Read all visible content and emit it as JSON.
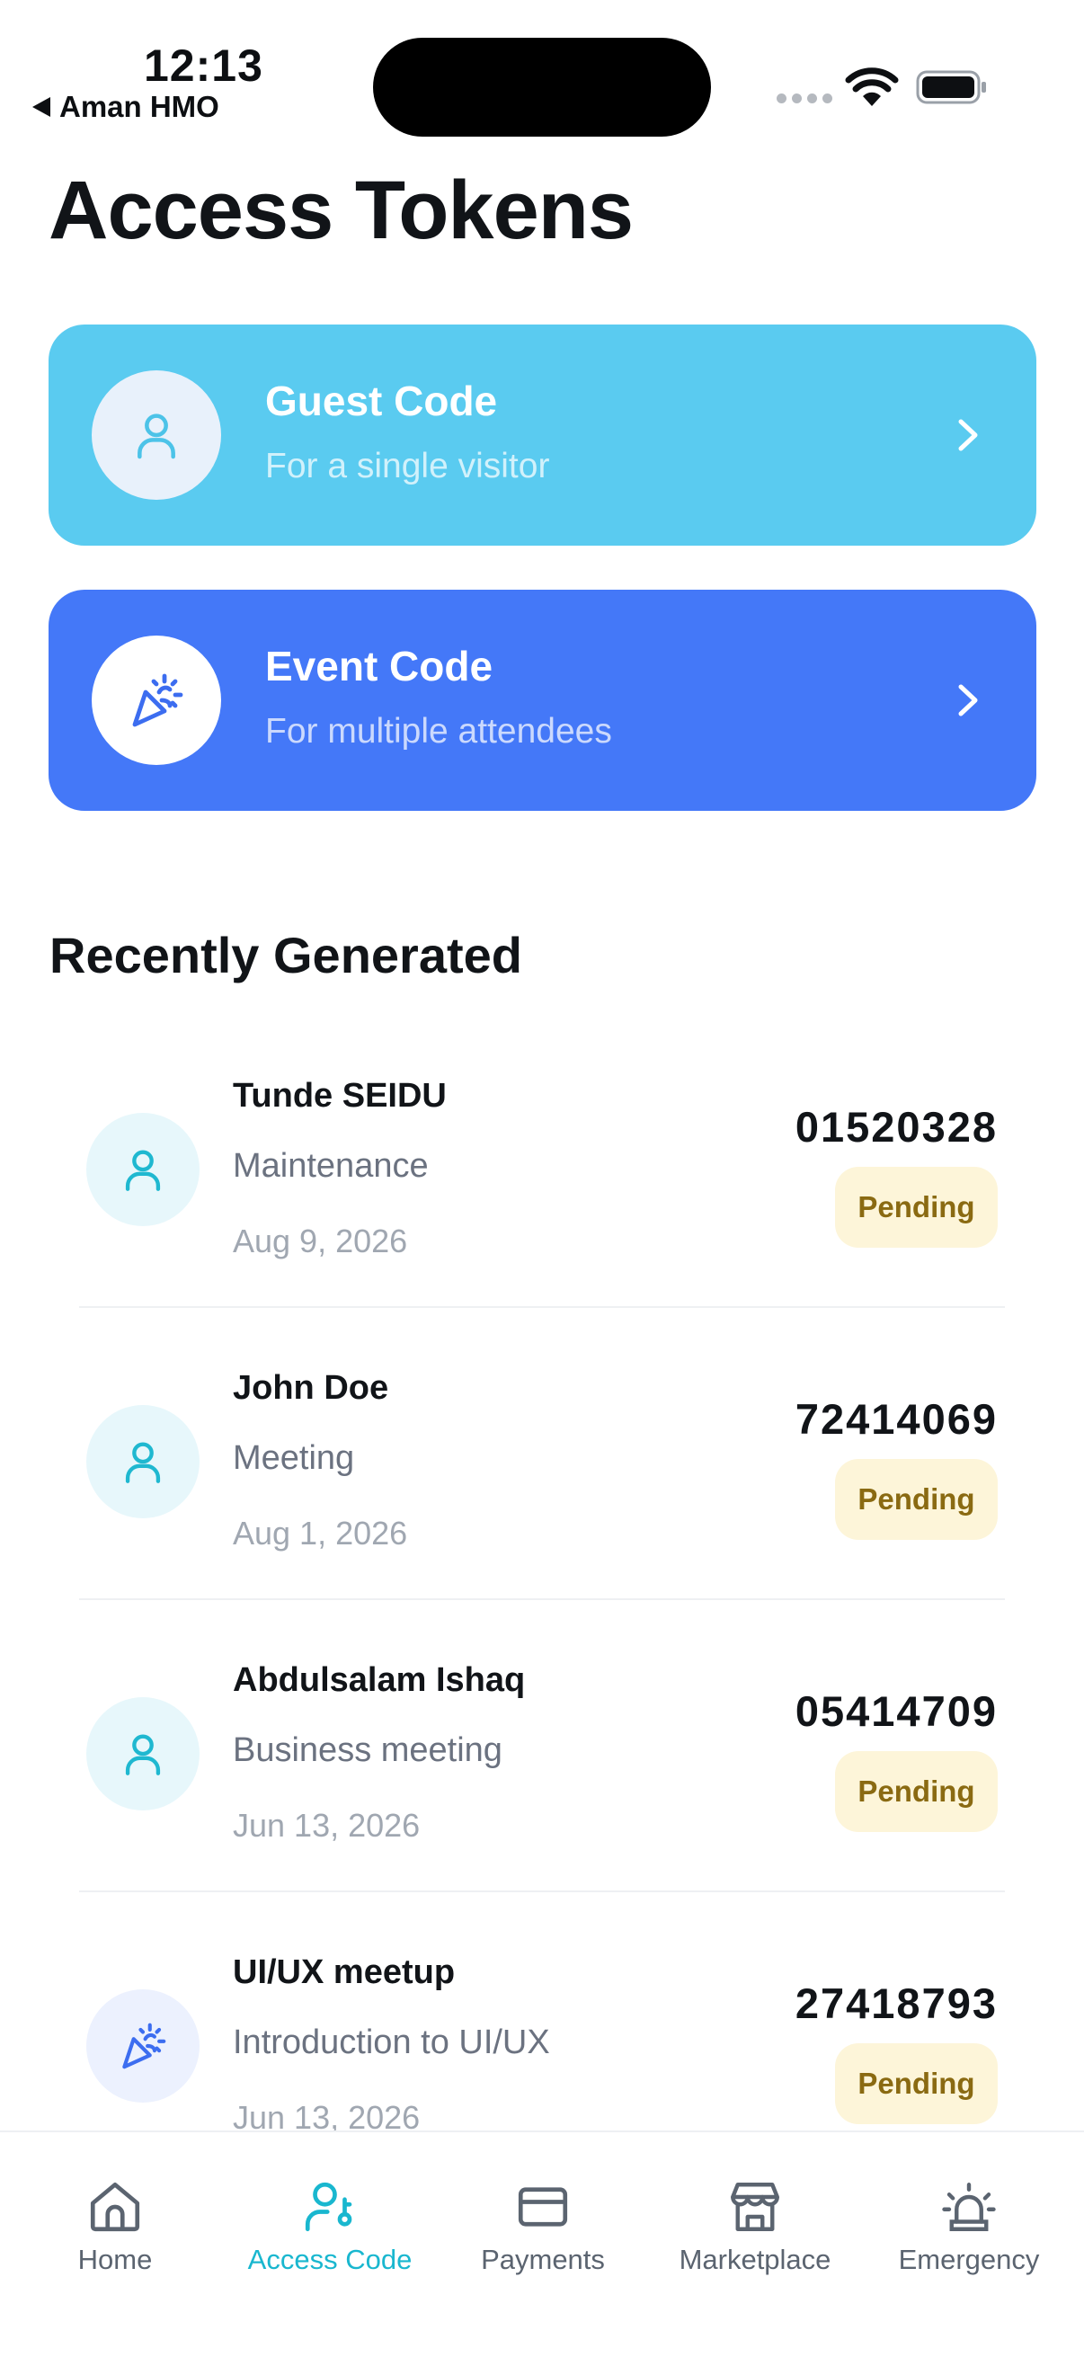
{
  "status_bar": {
    "time": "12:13",
    "back_app": "Aman HMO"
  },
  "page": {
    "title": "Access Tokens"
  },
  "cards": [
    {
      "title": "Guest Code",
      "subtitle": "For a single visitor",
      "icon": "user-icon",
      "color": "#5acbf0"
    },
    {
      "title": "Event Code",
      "subtitle": "For multiple attendees",
      "icon": "party-popper-icon",
      "color": "#4478f8"
    }
  ],
  "recent": {
    "title": "Recently Generated",
    "items": [
      {
        "name": "Tunde SEIDU",
        "purpose": "Maintenance",
        "date": "Aug 9, 2026",
        "code": "01520328",
        "status": "Pending",
        "icon": "user-icon"
      },
      {
        "name": "John Doe",
        "purpose": "Meeting",
        "date": "Aug 1, 2026",
        "code": "72414069",
        "status": "Pending",
        "icon": "user-icon"
      },
      {
        "name": "Abdulsalam Ishaq",
        "purpose": "Business meeting",
        "date": "Jun 13, 2026",
        "code": "05414709",
        "status": "Pending",
        "icon": "user-icon"
      },
      {
        "name": "UI/UX meetup",
        "purpose": "Introduction to UI/UX",
        "date": "Jun 13, 2026",
        "code": "27418793",
        "status": "Pending",
        "icon": "party-popper-icon"
      }
    ]
  },
  "tabs": [
    {
      "label": "Home",
      "icon": "home-icon",
      "active": false
    },
    {
      "label": "Access Code",
      "icon": "user-key-icon",
      "active": true
    },
    {
      "label": "Payments",
      "icon": "credit-card-icon",
      "active": false
    },
    {
      "label": "Marketplace",
      "icon": "store-icon",
      "active": false
    },
    {
      "label": "Emergency",
      "icon": "siren-icon",
      "active": false
    }
  ],
  "colors": {
    "accent": "#19b7cf",
    "pending_bg": "#fdf5d9",
    "pending_text": "#8a6a12"
  }
}
